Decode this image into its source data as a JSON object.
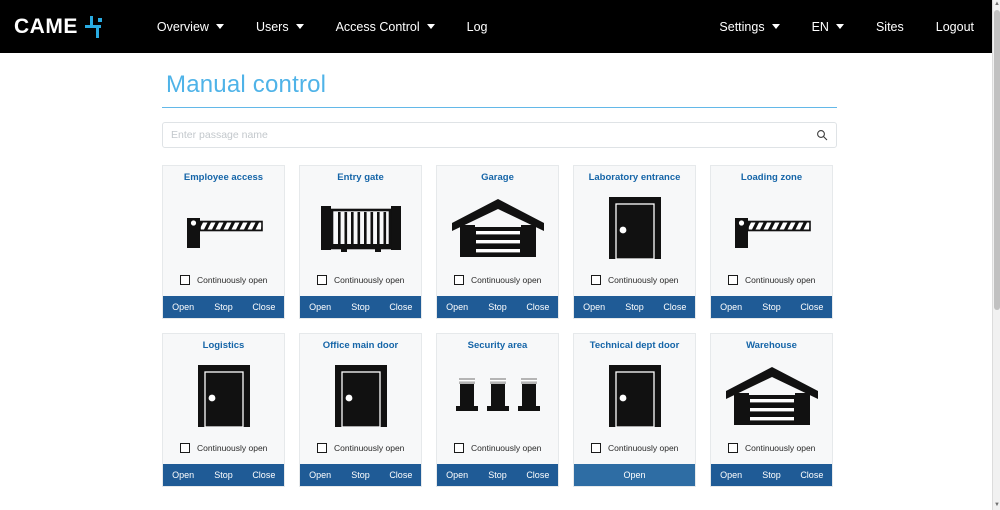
{
  "brand": {
    "name": "CAME",
    "logo_mark": "came-cross-icon",
    "accent": "#29ABE2"
  },
  "nav": {
    "left_items": [
      {
        "label": "Overview",
        "has_caret": true
      },
      {
        "label": "Users",
        "has_caret": true
      },
      {
        "label": "Access Control",
        "has_caret": true
      },
      {
        "label": "Log",
        "has_caret": false
      }
    ],
    "right_items": [
      {
        "label": "Settings",
        "has_caret": true
      },
      {
        "label": "EN",
        "has_caret": true
      },
      {
        "label": "Sites",
        "has_caret": false
      },
      {
        "label": "Logout",
        "has_caret": false
      }
    ]
  },
  "page": {
    "title": "Manual control",
    "title_color": "#4FB3E8"
  },
  "search": {
    "value": "",
    "placeholder": "Enter passage name",
    "icon": "search-icon"
  },
  "labels": {
    "continuously_open": "Continuously open",
    "open": "Open",
    "stop": "Stop",
    "close": "Close"
  },
  "colors": {
    "button_bar": "#2E6DA4",
    "button": "#1F5B96",
    "card_bg": "#f7f8f9",
    "card_title": "#1565A8"
  },
  "cards": [
    {
      "title": "Employee access",
      "icon": "barrier-icon",
      "checkbox_label": "Continuously open",
      "checked": false,
      "buttons": [
        "Open",
        "Stop",
        "Close"
      ]
    },
    {
      "title": "Entry gate",
      "icon": "gate-icon",
      "checkbox_label": "Continuously open",
      "checked": false,
      "buttons": [
        "Open",
        "Stop",
        "Close"
      ]
    },
    {
      "title": "Garage",
      "icon": "garage-icon",
      "checkbox_label": "Continuously open",
      "checked": false,
      "buttons": [
        "Open",
        "Stop",
        "Close"
      ]
    },
    {
      "title": "Laboratory entrance",
      "icon": "door-icon",
      "checkbox_label": "Continuously open",
      "checked": false,
      "buttons": [
        "Open",
        "Stop",
        "Close"
      ]
    },
    {
      "title": "Loading zone",
      "icon": "barrier-icon",
      "checkbox_label": "Continuously open",
      "checked": false,
      "buttons": [
        "Open",
        "Stop",
        "Close"
      ]
    },
    {
      "title": "Logistics",
      "icon": "door-icon",
      "checkbox_label": "Continuously open",
      "checked": false,
      "buttons": [
        "Open",
        "Stop",
        "Close"
      ]
    },
    {
      "title": "Office main door",
      "icon": "door-icon",
      "checkbox_label": "Continuously open",
      "checked": false,
      "buttons": [
        "Open",
        "Stop",
        "Close"
      ]
    },
    {
      "title": "Security area",
      "icon": "bollards-icon",
      "checkbox_label": "Continuously open",
      "checked": false,
      "buttons": [
        "Open",
        "Stop",
        "Close"
      ]
    },
    {
      "title": "Technical dept door",
      "icon": "door-icon",
      "checkbox_label": "Continuously open",
      "checked": false,
      "buttons": [
        "Open"
      ]
    },
    {
      "title": "Warehouse",
      "icon": "garage-icon",
      "checkbox_label": "Continuously open",
      "checked": false,
      "buttons": [
        "Open",
        "Stop",
        "Close"
      ]
    }
  ]
}
